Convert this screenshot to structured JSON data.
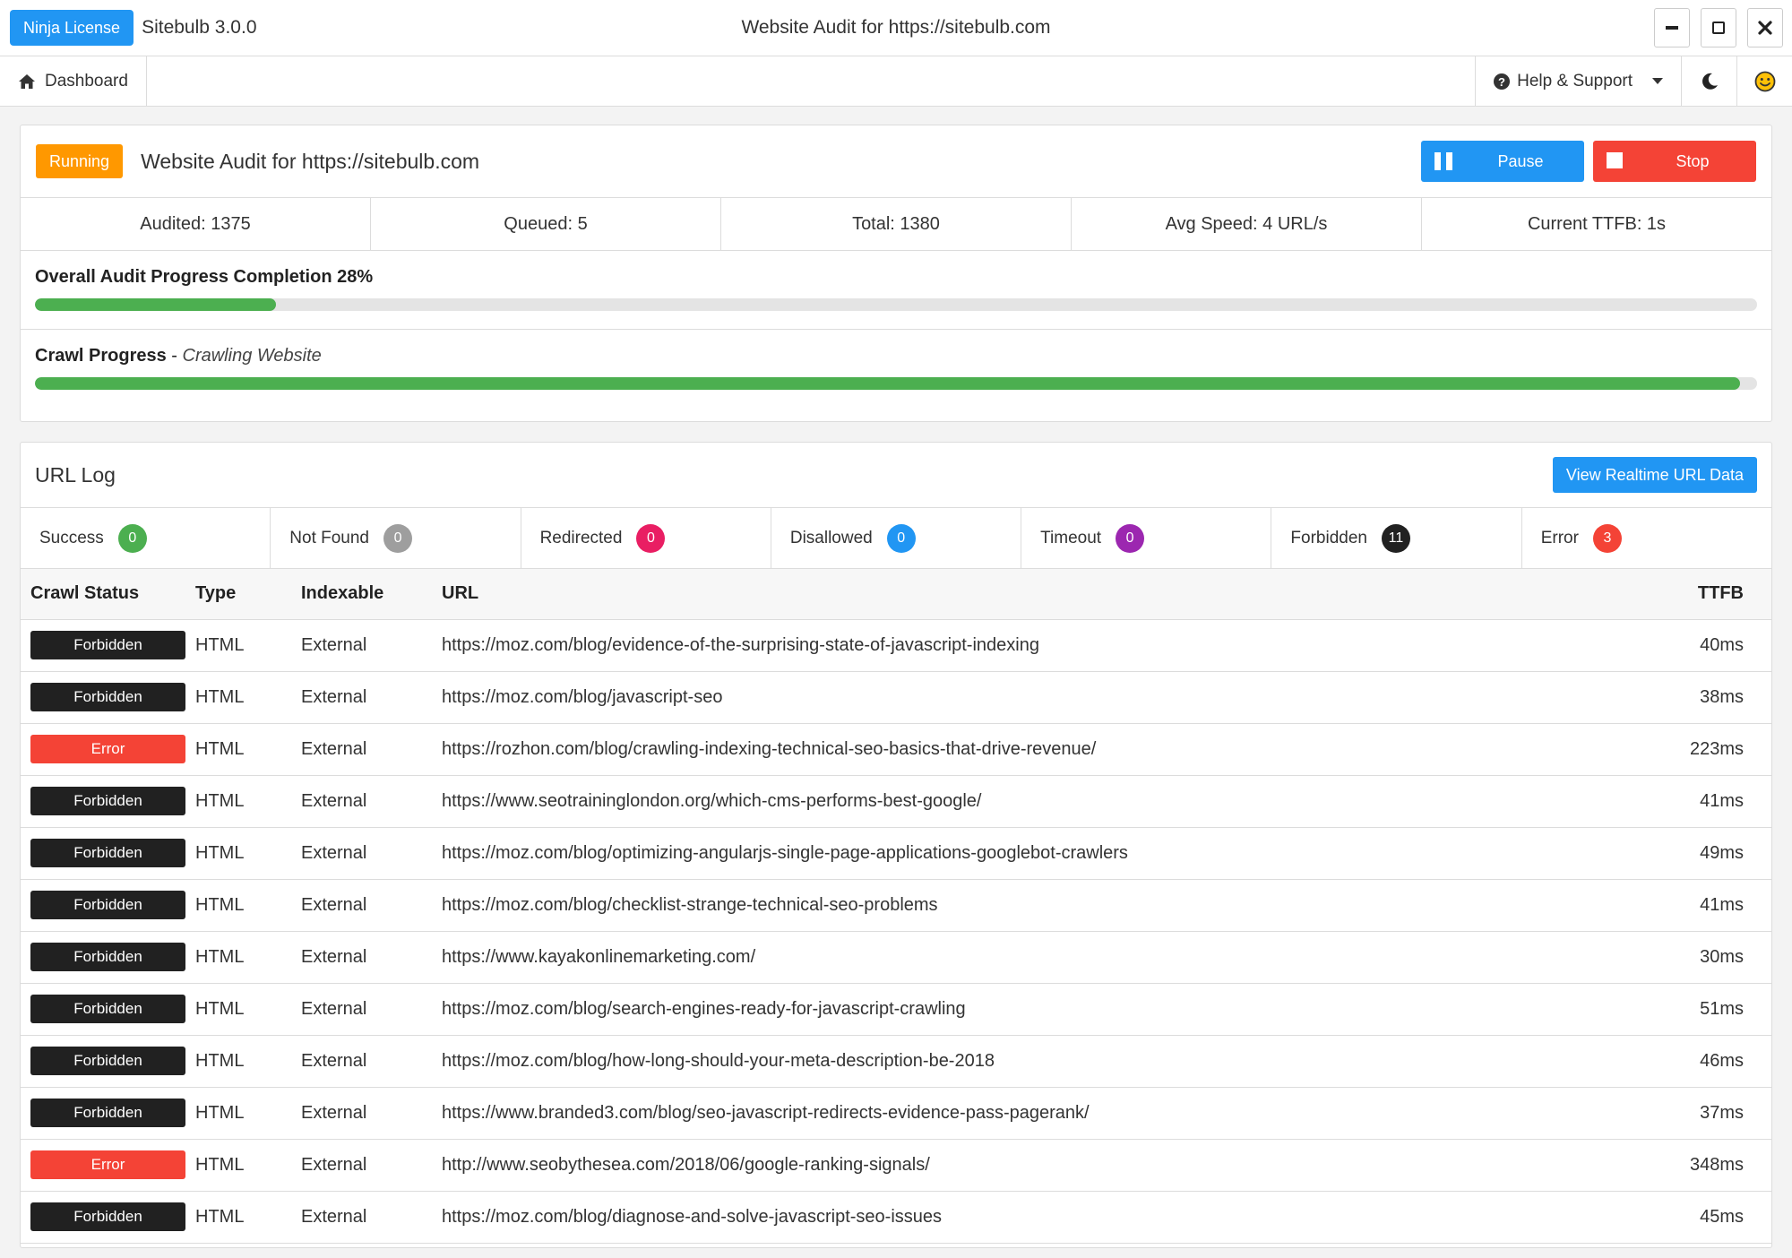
{
  "titlebar": {
    "license_badge": "Ninja License",
    "app_name": "Sitebulb 3.0.0",
    "window_title": "Website Audit for https://sitebulb.com"
  },
  "nav": {
    "dashboard": "Dashboard",
    "help": "Help & Support"
  },
  "audit": {
    "status": "Running",
    "title": "Website Audit for https://sitebulb.com",
    "pause_label": "Pause",
    "stop_label": "Stop",
    "stats": {
      "audited": "Audited: 1375",
      "queued": "Queued: 5",
      "total": "Total: 1380",
      "avg_speed": "Avg Speed: 4 URL/s",
      "ttfb": "Current TTFB:  1s"
    },
    "overall_label": "Overall Audit Progress Completion 28%",
    "overall_progress": 0.14,
    "crawl_label": "Crawl Progress",
    "crawl_sublabel": "Crawling Website",
    "crawl_progress": 0.99
  },
  "log": {
    "title": "URL Log",
    "realtime_button": "View Realtime URL Data",
    "filters": [
      {
        "label": "Success",
        "count": "0",
        "color": "#4caf50"
      },
      {
        "label": "Not Found",
        "count": "0",
        "color": "#9e9e9e"
      },
      {
        "label": "Redirected",
        "count": "0",
        "color": "#e91e63"
      },
      {
        "label": "Disallowed",
        "count": "0",
        "color": "#2196f3"
      },
      {
        "label": "Timeout",
        "count": "0",
        "color": "#9c27b0"
      },
      {
        "label": "Forbidden",
        "count": "11",
        "color": "#212121"
      },
      {
        "label": "Error",
        "count": "3",
        "color": "#f44336"
      }
    ],
    "columns": {
      "status": "Crawl Status",
      "type": "Type",
      "indexable": "Indexable",
      "url": "URL",
      "ttfb": "TTFB"
    },
    "status_colors": {
      "Forbidden": "#212121",
      "Error": "#f44336"
    },
    "rows": [
      {
        "status": "Forbidden",
        "type": "HTML",
        "indexable": "External",
        "url": "https://moz.com/blog/evidence-of-the-surprising-state-of-javascript-indexing",
        "ttfb": "40ms"
      },
      {
        "status": "Forbidden",
        "type": "HTML",
        "indexable": "External",
        "url": "https://moz.com/blog/javascript-seo",
        "ttfb": "38ms"
      },
      {
        "status": "Error",
        "type": "HTML",
        "indexable": "External",
        "url": "https://rozhon.com/blog/crawling-indexing-technical-seo-basics-that-drive-revenue/",
        "ttfb": "223ms"
      },
      {
        "status": "Forbidden",
        "type": "HTML",
        "indexable": "External",
        "url": "https://www.seotraininglondon.org/which-cms-performs-best-google/",
        "ttfb": "41ms"
      },
      {
        "status": "Forbidden",
        "type": "HTML",
        "indexable": "External",
        "url": "https://moz.com/blog/optimizing-angularjs-single-page-applications-googlebot-crawlers",
        "ttfb": "49ms"
      },
      {
        "status": "Forbidden",
        "type": "HTML",
        "indexable": "External",
        "url": "https://moz.com/blog/checklist-strange-technical-seo-problems",
        "ttfb": "41ms"
      },
      {
        "status": "Forbidden",
        "type": "HTML",
        "indexable": "External",
        "url": "https://www.kayakonlinemarketing.com/",
        "ttfb": "30ms"
      },
      {
        "status": "Forbidden",
        "type": "HTML",
        "indexable": "External",
        "url": "https://moz.com/blog/search-engines-ready-for-javascript-crawling",
        "ttfb": "51ms"
      },
      {
        "status": "Forbidden",
        "type": "HTML",
        "indexable": "External",
        "url": "https://moz.com/blog/how-long-should-your-meta-description-be-2018",
        "ttfb": "46ms"
      },
      {
        "status": "Forbidden",
        "type": "HTML",
        "indexable": "External",
        "url": "https://www.branded3.com/blog/seo-javascript-redirects-evidence-pass-pagerank/",
        "ttfb": "37ms"
      },
      {
        "status": "Error",
        "type": "HTML",
        "indexable": "External",
        "url": "http://www.seobythesea.com/2018/06/google-ranking-signals/",
        "ttfb": "348ms"
      },
      {
        "status": "Forbidden",
        "type": "HTML",
        "indexable": "External",
        "url": "https://moz.com/blog/diagnose-and-solve-javascript-seo-issues",
        "ttfb": "45ms"
      }
    ]
  },
  "icons": {
    "minimize": "minimize-icon",
    "maximize": "maximize-icon",
    "close": "close-icon",
    "home": "home-icon",
    "help": "question-circle-icon",
    "moon": "moon-icon",
    "smiley": "smiley-icon"
  }
}
